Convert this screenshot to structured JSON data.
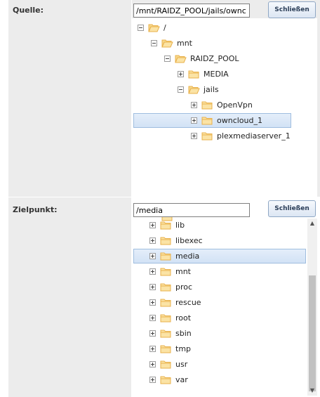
{
  "source": {
    "label": "Quelle:",
    "path_value": "/mnt/RAIDZ_POOL/jails/ownc",
    "close_label": "Schließen",
    "tree": [
      {
        "label": "/",
        "toggle": "minus",
        "open": true
      },
      {
        "label": "mnt",
        "toggle": "minus",
        "open": true
      },
      {
        "label": "RAIDZ_POOL",
        "toggle": "minus",
        "open": true
      },
      {
        "label": "MEDIA",
        "toggle": "plus",
        "open": false
      },
      {
        "label": "jails",
        "toggle": "minus",
        "open": true
      },
      {
        "label": "OpenVpn",
        "toggle": "plus",
        "open": false
      },
      {
        "label": "owncloud_1",
        "toggle": "plus",
        "open": false,
        "selected": true
      },
      {
        "label": "plexmediaserver_1",
        "toggle": "plus",
        "open": false
      }
    ]
  },
  "target": {
    "label": "Zielpunkt:",
    "path_value": "/media",
    "close_label": "Schließen",
    "tree": [
      {
        "label": "lib",
        "toggle": "plus"
      },
      {
        "label": "libexec",
        "toggle": "plus"
      },
      {
        "label": "media",
        "toggle": "plus",
        "selected": true
      },
      {
        "label": "mnt",
        "toggle": "plus"
      },
      {
        "label": "proc",
        "toggle": "plus"
      },
      {
        "label": "rescue",
        "toggle": "plus"
      },
      {
        "label": "root",
        "toggle": "plus"
      },
      {
        "label": "sbin",
        "toggle": "plus"
      },
      {
        "label": "tmp",
        "toggle": "plus"
      },
      {
        "label": "usr",
        "toggle": "plus"
      },
      {
        "label": "var",
        "toggle": "plus"
      }
    ],
    "scrollbar": {
      "arrow_up": "▲",
      "arrow_down": "▼"
    }
  },
  "icons": {
    "folder_closed": "folder-icon",
    "folder_open": "folder-open-icon",
    "folder_color": "#e8b04a",
    "selection_color": "#d9e7f7"
  }
}
